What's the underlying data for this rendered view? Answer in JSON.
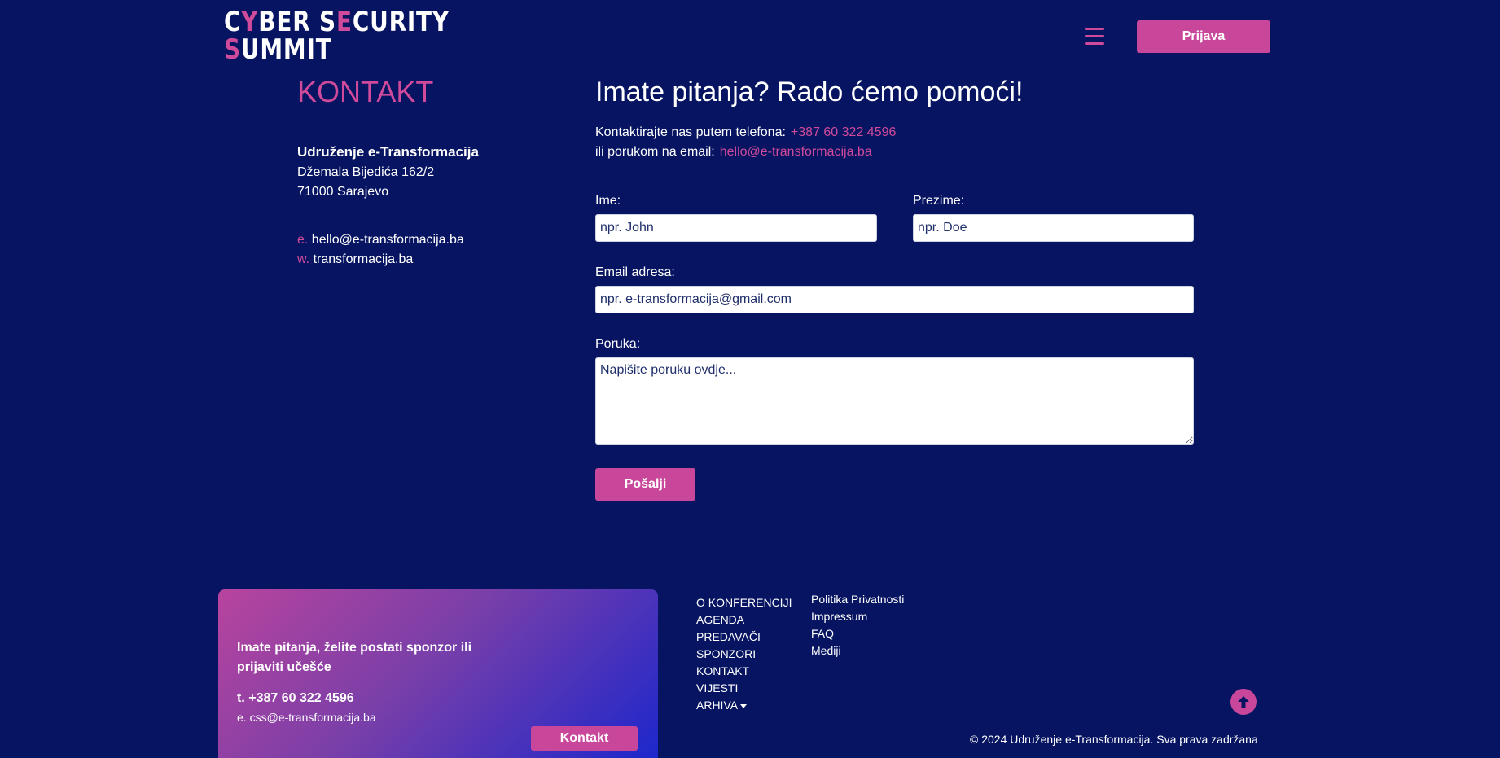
{
  "logo": {
    "line1_a": "C",
    "line1_b": "Y",
    "line1_c": "BER S",
    "line1_d": "E",
    "line1_e": "CURITY",
    "line2_a": "S",
    "line2_b": "UMMIT"
  },
  "header": {
    "login_label": "Prijava",
    "menu_icon": "hamburger-icon"
  },
  "left": {
    "heading": "KONTAKT",
    "org": "Udruženje e-Transformacija",
    "address1": "Džemala Bijedića 162/2",
    "address2": "71000 Sarajevo",
    "email_prefix": "e.",
    "email": "hello@e-transformacija.ba",
    "web_prefix": "w.",
    "web": "transformacija.ba"
  },
  "form": {
    "heading": "Imate pitanja? Rado ćemo pomoći!",
    "phone_text": "Kontaktirajte nas putem telefona:",
    "phone": "+387 60 322 4596",
    "email_text": "ili porukom na email:",
    "email": "hello@e-transformacija.ba",
    "first_name_label": "Ime:",
    "first_name_placeholder": "npr. John",
    "last_name_label": "Prezime:",
    "last_name_placeholder": "npr. Doe",
    "email_label": "Email adresa:",
    "email_placeholder": "npr. e-transformacija@gmail.com",
    "message_label": "Poruka:",
    "message_placeholder": "Napišite poruku ovdje...",
    "submit_label": "Pošalji"
  },
  "footer": {
    "card_question": "Imate pitanja, želite postati sponzor ili prijaviti učešće",
    "card_phone": "t. +387 60 322 4596",
    "card_email": "e. css@e-transformacija.ba",
    "card_button": "Kontakt",
    "nav": [
      "O KONFERENCIJI",
      "AGENDA",
      "PREDAVAČI",
      "SPONZORI",
      "KONTAKT",
      "VIJESTI",
      "ARHIVA"
    ],
    "links": [
      "Politika Privatnosti",
      "Impressum",
      "FAQ",
      "Mediji"
    ],
    "copyright": "© 2024 Udruženje e-Transformacija. Sva prava zadržana"
  },
  "colors": {
    "background": "#061461",
    "accent": "#d04a9b",
    "button": "#c9479a"
  }
}
